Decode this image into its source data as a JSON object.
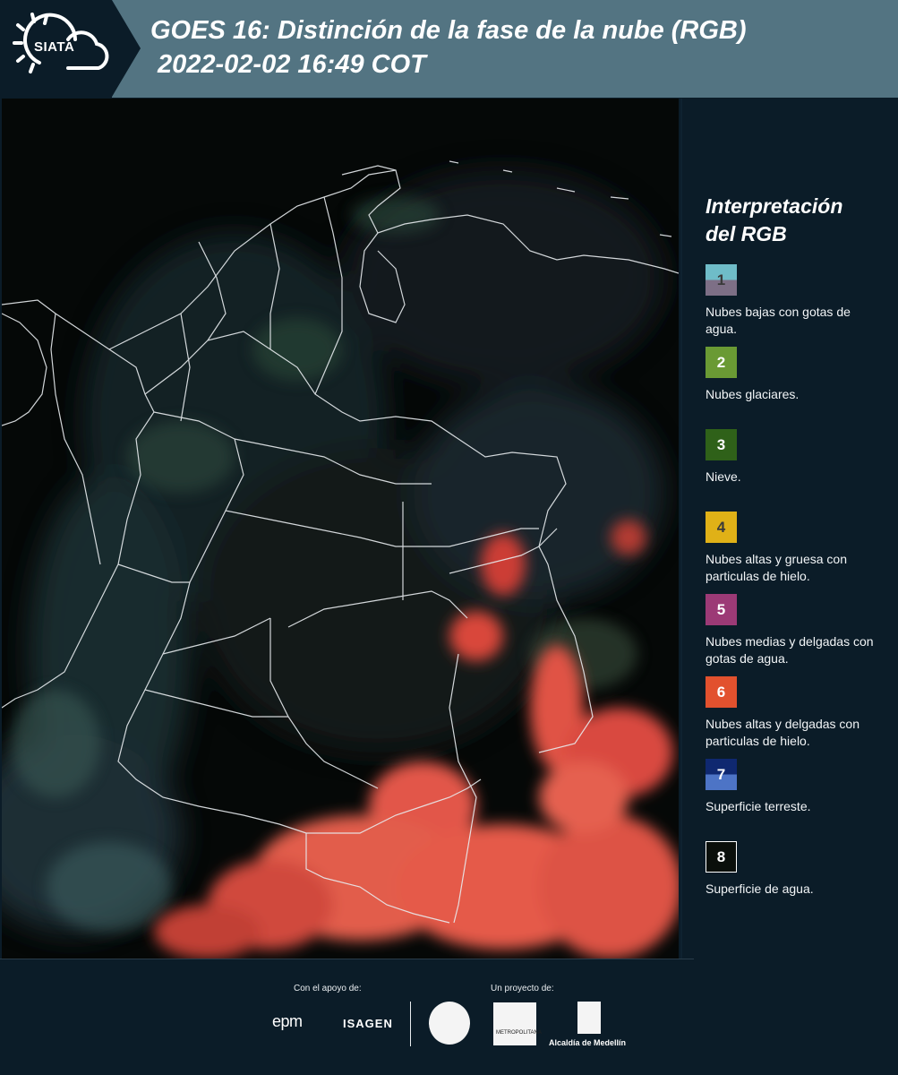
{
  "header": {
    "logo_text": "SIATA",
    "title": "GOES 16: Distinción de la fase de la nube (RGB)",
    "subtitle": "2022-02-02 16:49 COT"
  },
  "legend": {
    "title_line1": "Interpretación",
    "title_line2": "del RGB",
    "items": [
      {
        "number": "1",
        "label": "Nubes bajas con gotas de agua.",
        "color_top": "#6fbcc8",
        "color_bottom": "#7d6f86",
        "num_color": "#3a3a3a"
      },
      {
        "number": "2",
        "label": "Nubes glaciares.",
        "color_top": "#6a9a34",
        "color_bottom": "#6a9a34",
        "num_color": "#ffffff"
      },
      {
        "number": "3",
        "label": "Nieve.",
        "color_top": "#2f6119",
        "color_bottom": "#2f6119",
        "num_color": "#ffffff"
      },
      {
        "number": "4",
        "label": "Nubes altas y gruesa con particulas de hielo.",
        "color_top": "#e0b117",
        "color_bottom": "#e0b117",
        "num_color": "#3a3a3a"
      },
      {
        "number": "5",
        "label": "Nubes medias y delgadas con gotas de agua.",
        "color_top": "#9c3a76",
        "color_bottom": "#9c3a76",
        "num_color": "#ffffff"
      },
      {
        "number": "6",
        "label": "Nubes altas y delgadas con particulas de hielo.",
        "color_top": "#e2512e",
        "color_bottom": "#e2512e",
        "num_color": "#ffffff"
      },
      {
        "number": "7",
        "label": "Superficie terreste.",
        "color_top": "#0f2870",
        "color_bottom": "#4d74c6",
        "num_color": "#ffffff"
      },
      {
        "number": "8",
        "label": "Superficie de agua.",
        "color_top": "#0a0f0b",
        "color_bottom": "#0a0f0b",
        "num_color": "#ffffff"
      }
    ]
  },
  "footer": {
    "support_label": "Con el apoyo de:",
    "project_label": "Un proyecto de:",
    "epm": "epm",
    "isagen": "ISAGEN",
    "area_text": "METROPOLITANA",
    "medellin": "Alcaldía de Medellín"
  }
}
